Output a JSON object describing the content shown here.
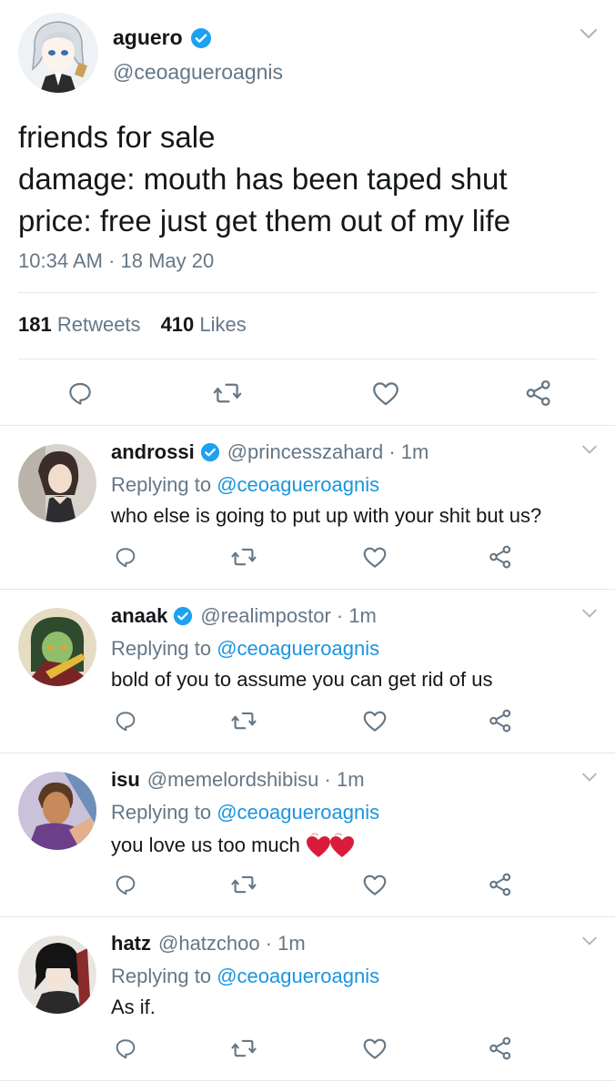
{
  "tweet": {
    "author_name": "aguero",
    "author_handle": "@ceoagueroagnis",
    "lines": [
      "friends for sale",
      "damage: mouth has been taped shut",
      "price: free just get them out of my life"
    ],
    "timestamp": "10:34 AM · 18 May 20",
    "retweets_count": "181",
    "retweets_label": "Retweets",
    "likes_count": "410",
    "likes_label": "Likes",
    "verified": true
  },
  "replies": [
    {
      "name": "androssi",
      "verified": true,
      "handle": "@princesszahard · 1m",
      "replying_prefix": "Replying to ",
      "replying_to": "@ceoagueroagnis",
      "text": "who else is going to put up with your shit but us?",
      "emoji": ""
    },
    {
      "name": "anaak",
      "verified": true,
      "handle": "@realimpostor · 1m",
      "replying_prefix": "Replying to ",
      "replying_to": "@ceoagueroagnis",
      "text": "bold of you to assume you can get rid of us",
      "emoji": ""
    },
    {
      "name": "isu",
      "verified": false,
      "handle": "@memelordshibisu · 1m",
      "replying_prefix": "Replying to ",
      "replying_to": "@ceoagueroagnis",
      "text": "you love us too much",
      "emoji": "two-hearts"
    },
    {
      "name": "hatz",
      "verified": false,
      "handle": "@hatzchoo · 1m",
      "replying_prefix": "Replying to ",
      "replying_to": "@ceoagueroagnis",
      "text": "As if.",
      "emoji": ""
    }
  ],
  "colors": {
    "accent": "#1b95e0",
    "muted": "#657786",
    "text": "#14171a",
    "border": "#e1e8ed",
    "verified": "#1da1f2",
    "heart": "#e0245e"
  },
  "icons": {
    "reply": "reply-icon",
    "retweet": "retweet-icon",
    "like": "heart-icon",
    "share": "share-icon",
    "more": "chevron-down-icon",
    "verified": "verified-badge-icon"
  }
}
